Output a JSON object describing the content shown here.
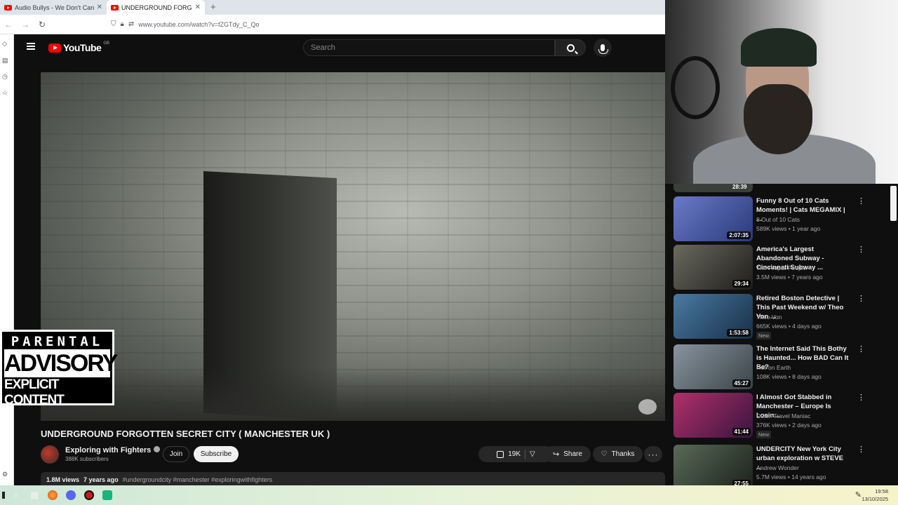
{
  "browser": {
    "tabs": [
      {
        "title": "Audio Bullys - We Don't Care (C...",
        "active": false
      },
      {
        "title": "UNDERGROUND FORGOTT...",
        "active": true
      }
    ],
    "new_tab": "+",
    "url": "www.youtube.com/watch?v=fZGTdy_C_Qo"
  },
  "youtube": {
    "logo_text": "YouTube",
    "logo_region": "GB",
    "search_placeholder": "Search"
  },
  "video": {
    "title": "UNDERGROUND FORGOTTEN SECRET CITY ( MANCHESTER UK )",
    "channel": "Exploring with Fighters",
    "subscribers": "388K subscribers",
    "join_label": "Join",
    "subscribe_label": "Subscribe",
    "likes": "19K",
    "share_label": "Share",
    "thanks_label": "Thanks",
    "views": "1.8M views",
    "age": "7 years ago",
    "tags": "#undergroundcity #manchester #exploringwithfighters"
  },
  "advisory": {
    "line1": "PARENTAL",
    "line2": "ADVISORY",
    "line3": "EXPLICIT CONTENT"
  },
  "related": {
    "partial_duration": "28:39",
    "items": [
      {
        "title": "Funny 8 Out of 10 Cats Moments! | Cats MEGAMIX | ...",
        "channel": "8 Out of 10 Cats",
        "meta": "589K views • 1 year ago",
        "duration": "2:07:35",
        "new": "",
        "thumb": "#4a5aa8"
      },
      {
        "title": "America's Largest Abandoned Subway - Cincinnati Subway ...",
        "channel": "The Proper People",
        "meta": "3.5M views • 7 years ago",
        "duration": "29:34",
        "new": "",
        "thumb": "#3b3a34"
      },
      {
        "title": "Retired Boston Detective | This Past Weekend w/ Theo Von ...",
        "channel": "Theo Von",
        "meta": "665K views • 4 days ago",
        "duration": "1:53:58",
        "new": "New",
        "thumb": "#2a4a6a"
      },
      {
        "title": "The Internet Said This Bothy is Haunted... How BAD Can It Be?",
        "channel": "Hell on Earth",
        "meta": "108K views • 8 days ago",
        "duration": "45:27",
        "new": "",
        "thumb": "#5b6470"
      },
      {
        "title": "I Almost Got Stabbed in Manchester – Europe Is Losin...",
        "channel": "Dutch Travel Maniac",
        "meta": "376K views • 2 days ago",
        "duration": "41:44",
        "new": "New",
        "thumb": "#6a1f5a"
      },
      {
        "title": "UNDERCITY New York City urban exploration w STEVE ...",
        "channel": "Andrew Wonder",
        "meta": "5.7M views • 14 years ago",
        "duration": "27:55",
        "new": "",
        "thumb": "#3c4a3a"
      }
    ]
  },
  "taskbar": {
    "time": "19:58",
    "date": "13/10/2025"
  }
}
